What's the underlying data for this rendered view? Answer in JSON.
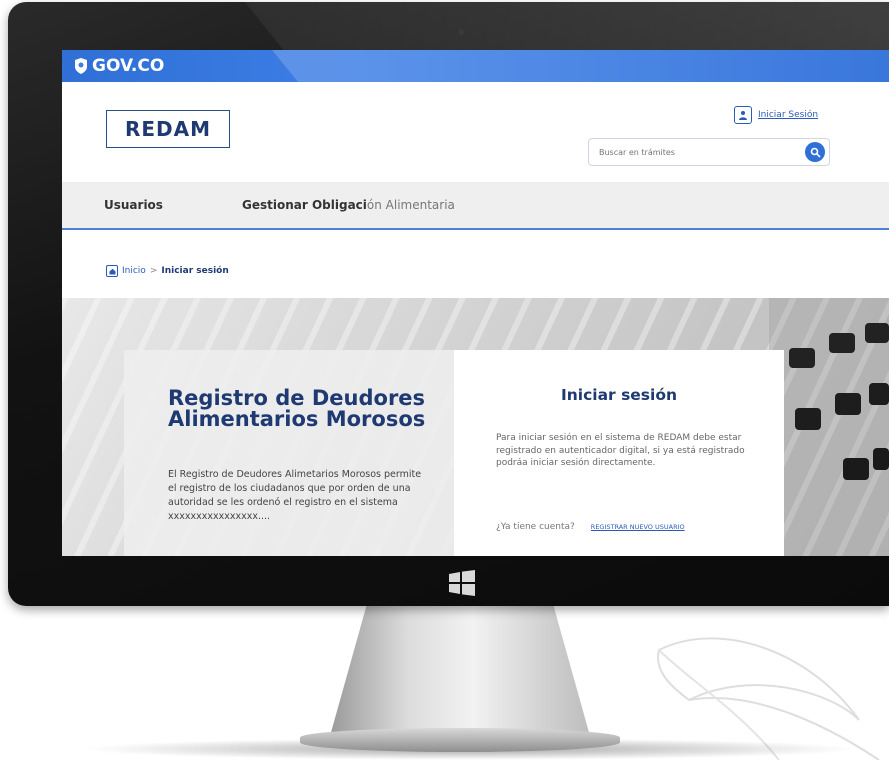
{
  "gov_bar": {
    "logo_text": "GOV.CO"
  },
  "header": {
    "brand": "REDAM",
    "login_link": "Iniciar Sesión",
    "search": {
      "placeholder": "Buscar en trámites"
    }
  },
  "nav": {
    "items": [
      {
        "label": "Usuarios"
      },
      {
        "label_bold": "Gestionar Obligaci",
        "label_light": "ón Alimentaria"
      }
    ]
  },
  "breadcrumb": {
    "home": "Inicio",
    "separator": ">",
    "current": "Iniciar sesión"
  },
  "info_card": {
    "title": "Registro de Deudores Alimentarios Morosos",
    "text": "El Registro de Deudores Alimetarios Morosos permite el registro de los ciudadanos que por orden de una autoridad se les ordenó el registro en el sistema xxxxxxxxxxxxxxxx...."
  },
  "login_card": {
    "title": "Iniciar sesión",
    "description": "Para iniciar sesión en el sistema de REDAM debe estar registrado en autenticador digital, si ya está registrado podráa iniciar sesión directamente.",
    "account_question": "¿Ya tiene cuenta?",
    "register_link": "REGISTRAR NUEVO USUARIO"
  },
  "colors": {
    "gov_blue": "#3d7fe6",
    "brand_navy": "#1f3a73",
    "link_blue": "#2b5bb8"
  }
}
